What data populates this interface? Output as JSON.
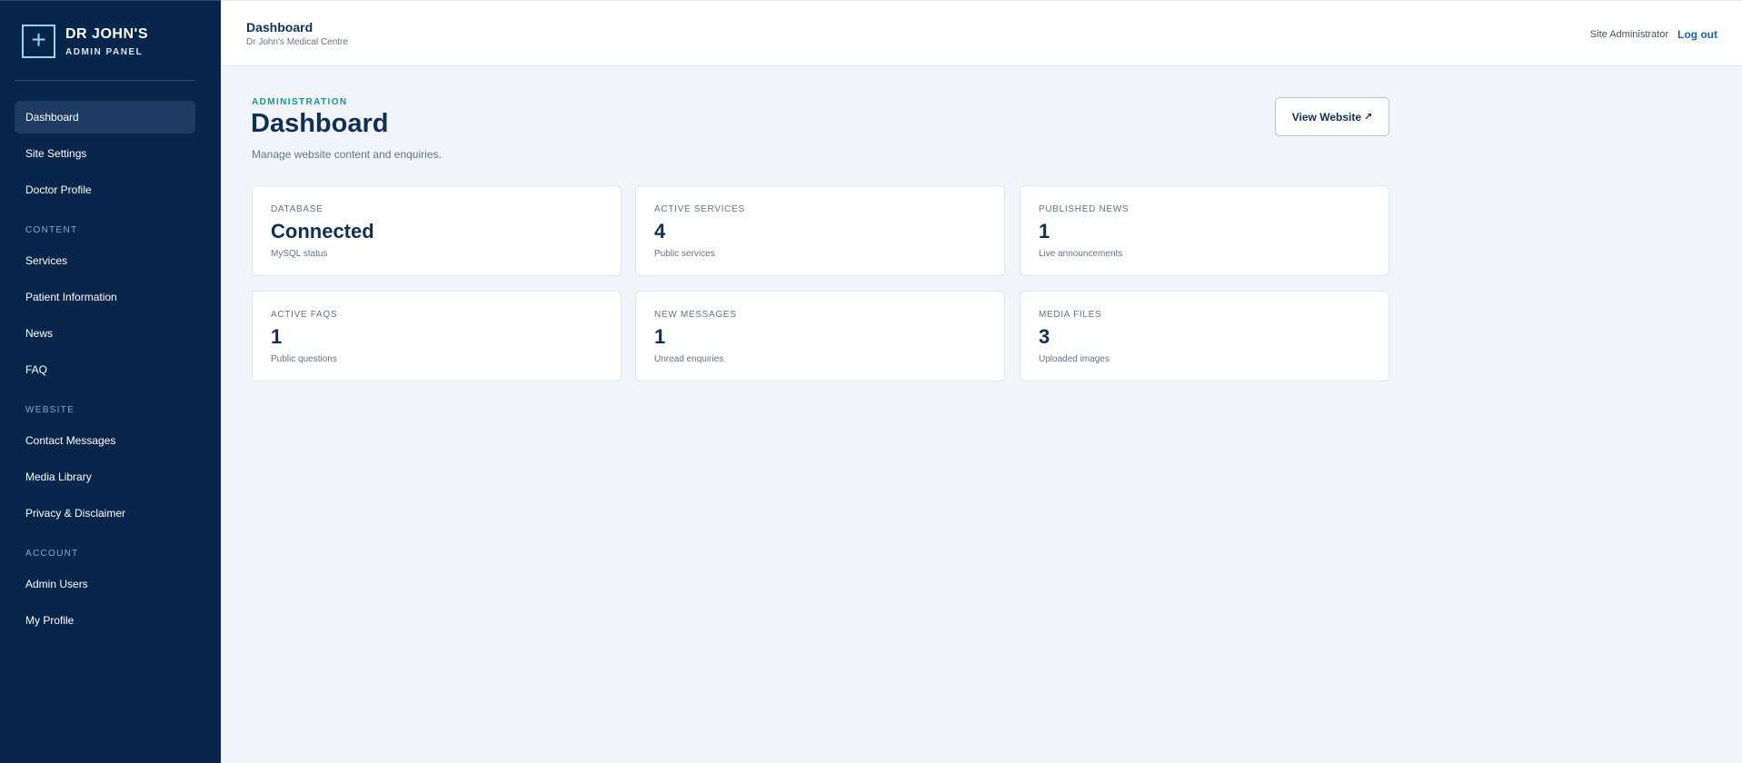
{
  "brand": {
    "title": "DR JOHN'S",
    "subtitle": "ADMIN PANEL",
    "icon": "plus-icon"
  },
  "sidebar": {
    "items": [
      {
        "label": "Dashboard"
      },
      {
        "label": "Site Settings"
      },
      {
        "label": "Doctor Profile"
      },
      {
        "label": "Services"
      },
      {
        "label": "Patient Information"
      },
      {
        "label": "News"
      },
      {
        "label": "FAQ"
      },
      {
        "label": "Contact Messages"
      },
      {
        "label": "Media Library"
      },
      {
        "label": "Privacy & Disclaimer"
      },
      {
        "label": "Admin Users"
      },
      {
        "label": "My Profile"
      }
    ],
    "sections": [
      "CONTENT",
      "WEBSITE",
      "ACCOUNT"
    ],
    "active": "Dashboard"
  },
  "topbar": {
    "title": "Dashboard",
    "subtitle": "Dr John's Medical Centre",
    "user": "Site Administrator",
    "logout": "Log out"
  },
  "main": {
    "eyebrow": "ADMINISTRATION",
    "title": "Dashboard",
    "description": "Manage website content and enquiries.",
    "view_button": "View Website",
    "view_button_icon": "↗"
  },
  "cards": [
    {
      "label": "DATABASE",
      "value": "Connected",
      "note": "MySQL status"
    },
    {
      "label": "ACTIVE SERVICES",
      "value": "4",
      "note": "Public services"
    },
    {
      "label": "PUBLISHED NEWS",
      "value": "1",
      "note": "Live announcements"
    },
    {
      "label": "ACTIVE FAQS",
      "value": "1",
      "note": "Public questions"
    },
    {
      "label": "NEW MESSAGES",
      "value": "1",
      "note": "Unread enquiries"
    },
    {
      "label": "MEDIA FILES",
      "value": "3",
      "note": "Uploaded images"
    }
  ],
  "colors": {
    "sidebar_bg": "#08264c",
    "accent_teal": "#1196a3",
    "link_blue": "#1763b5",
    "heading_navy": "#0f2f57"
  }
}
